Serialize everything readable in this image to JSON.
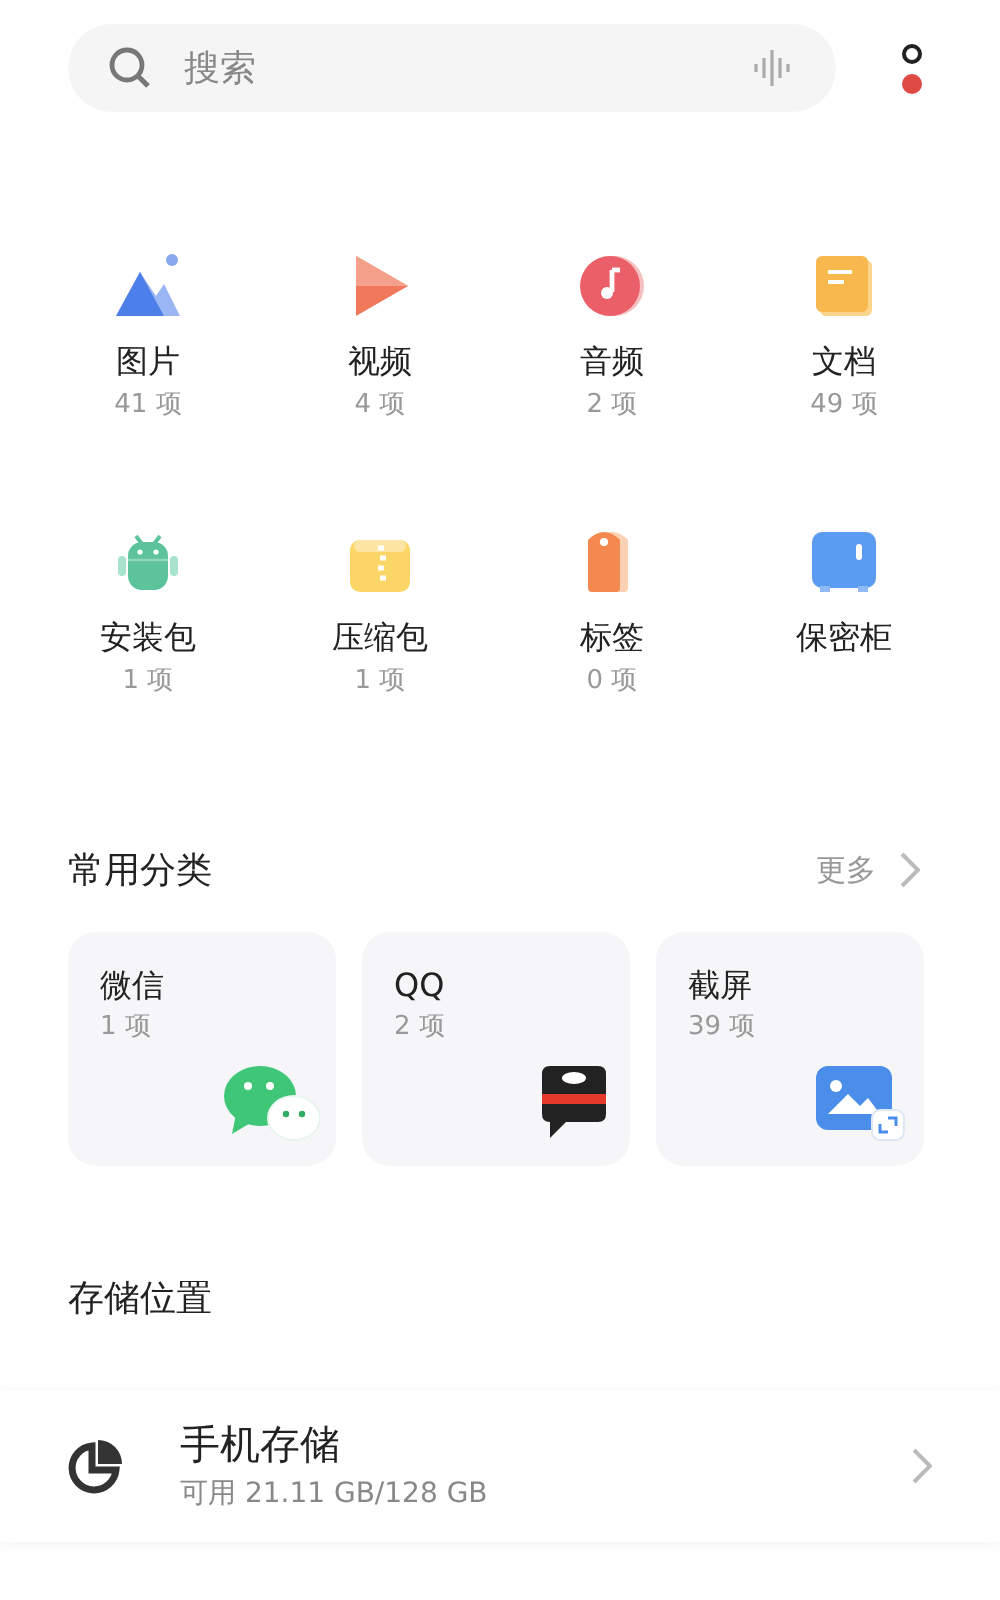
{
  "search": {
    "placeholder": "搜索"
  },
  "categories": [
    {
      "kind": "image",
      "label": "图片",
      "count": "41 项"
    },
    {
      "kind": "video",
      "label": "视频",
      "count": "4 项"
    },
    {
      "kind": "audio",
      "label": "音频",
      "count": "2 项"
    },
    {
      "kind": "document",
      "label": "文档",
      "count": "49 项"
    },
    {
      "kind": "apk",
      "label": "安装包",
      "count": "1 项"
    },
    {
      "kind": "archive",
      "label": "压缩包",
      "count": "1 项"
    },
    {
      "kind": "tag",
      "label": "标签",
      "count": "0 项"
    },
    {
      "kind": "safe",
      "label": "保密柜"
    }
  ],
  "common": {
    "title": "常用分类",
    "more": "更多",
    "cards": [
      {
        "kind": "wechat",
        "label": "微信",
        "count": "1 项"
      },
      {
        "kind": "qq",
        "label": "QQ",
        "count": "2 项"
      },
      {
        "kind": "screenshot",
        "label": "截屏",
        "count": "39 项"
      }
    ]
  },
  "storage": {
    "title": "存储位置",
    "items": [
      {
        "name": "手机存储",
        "detail": "可用 21.11 GB/128 GB"
      }
    ]
  }
}
